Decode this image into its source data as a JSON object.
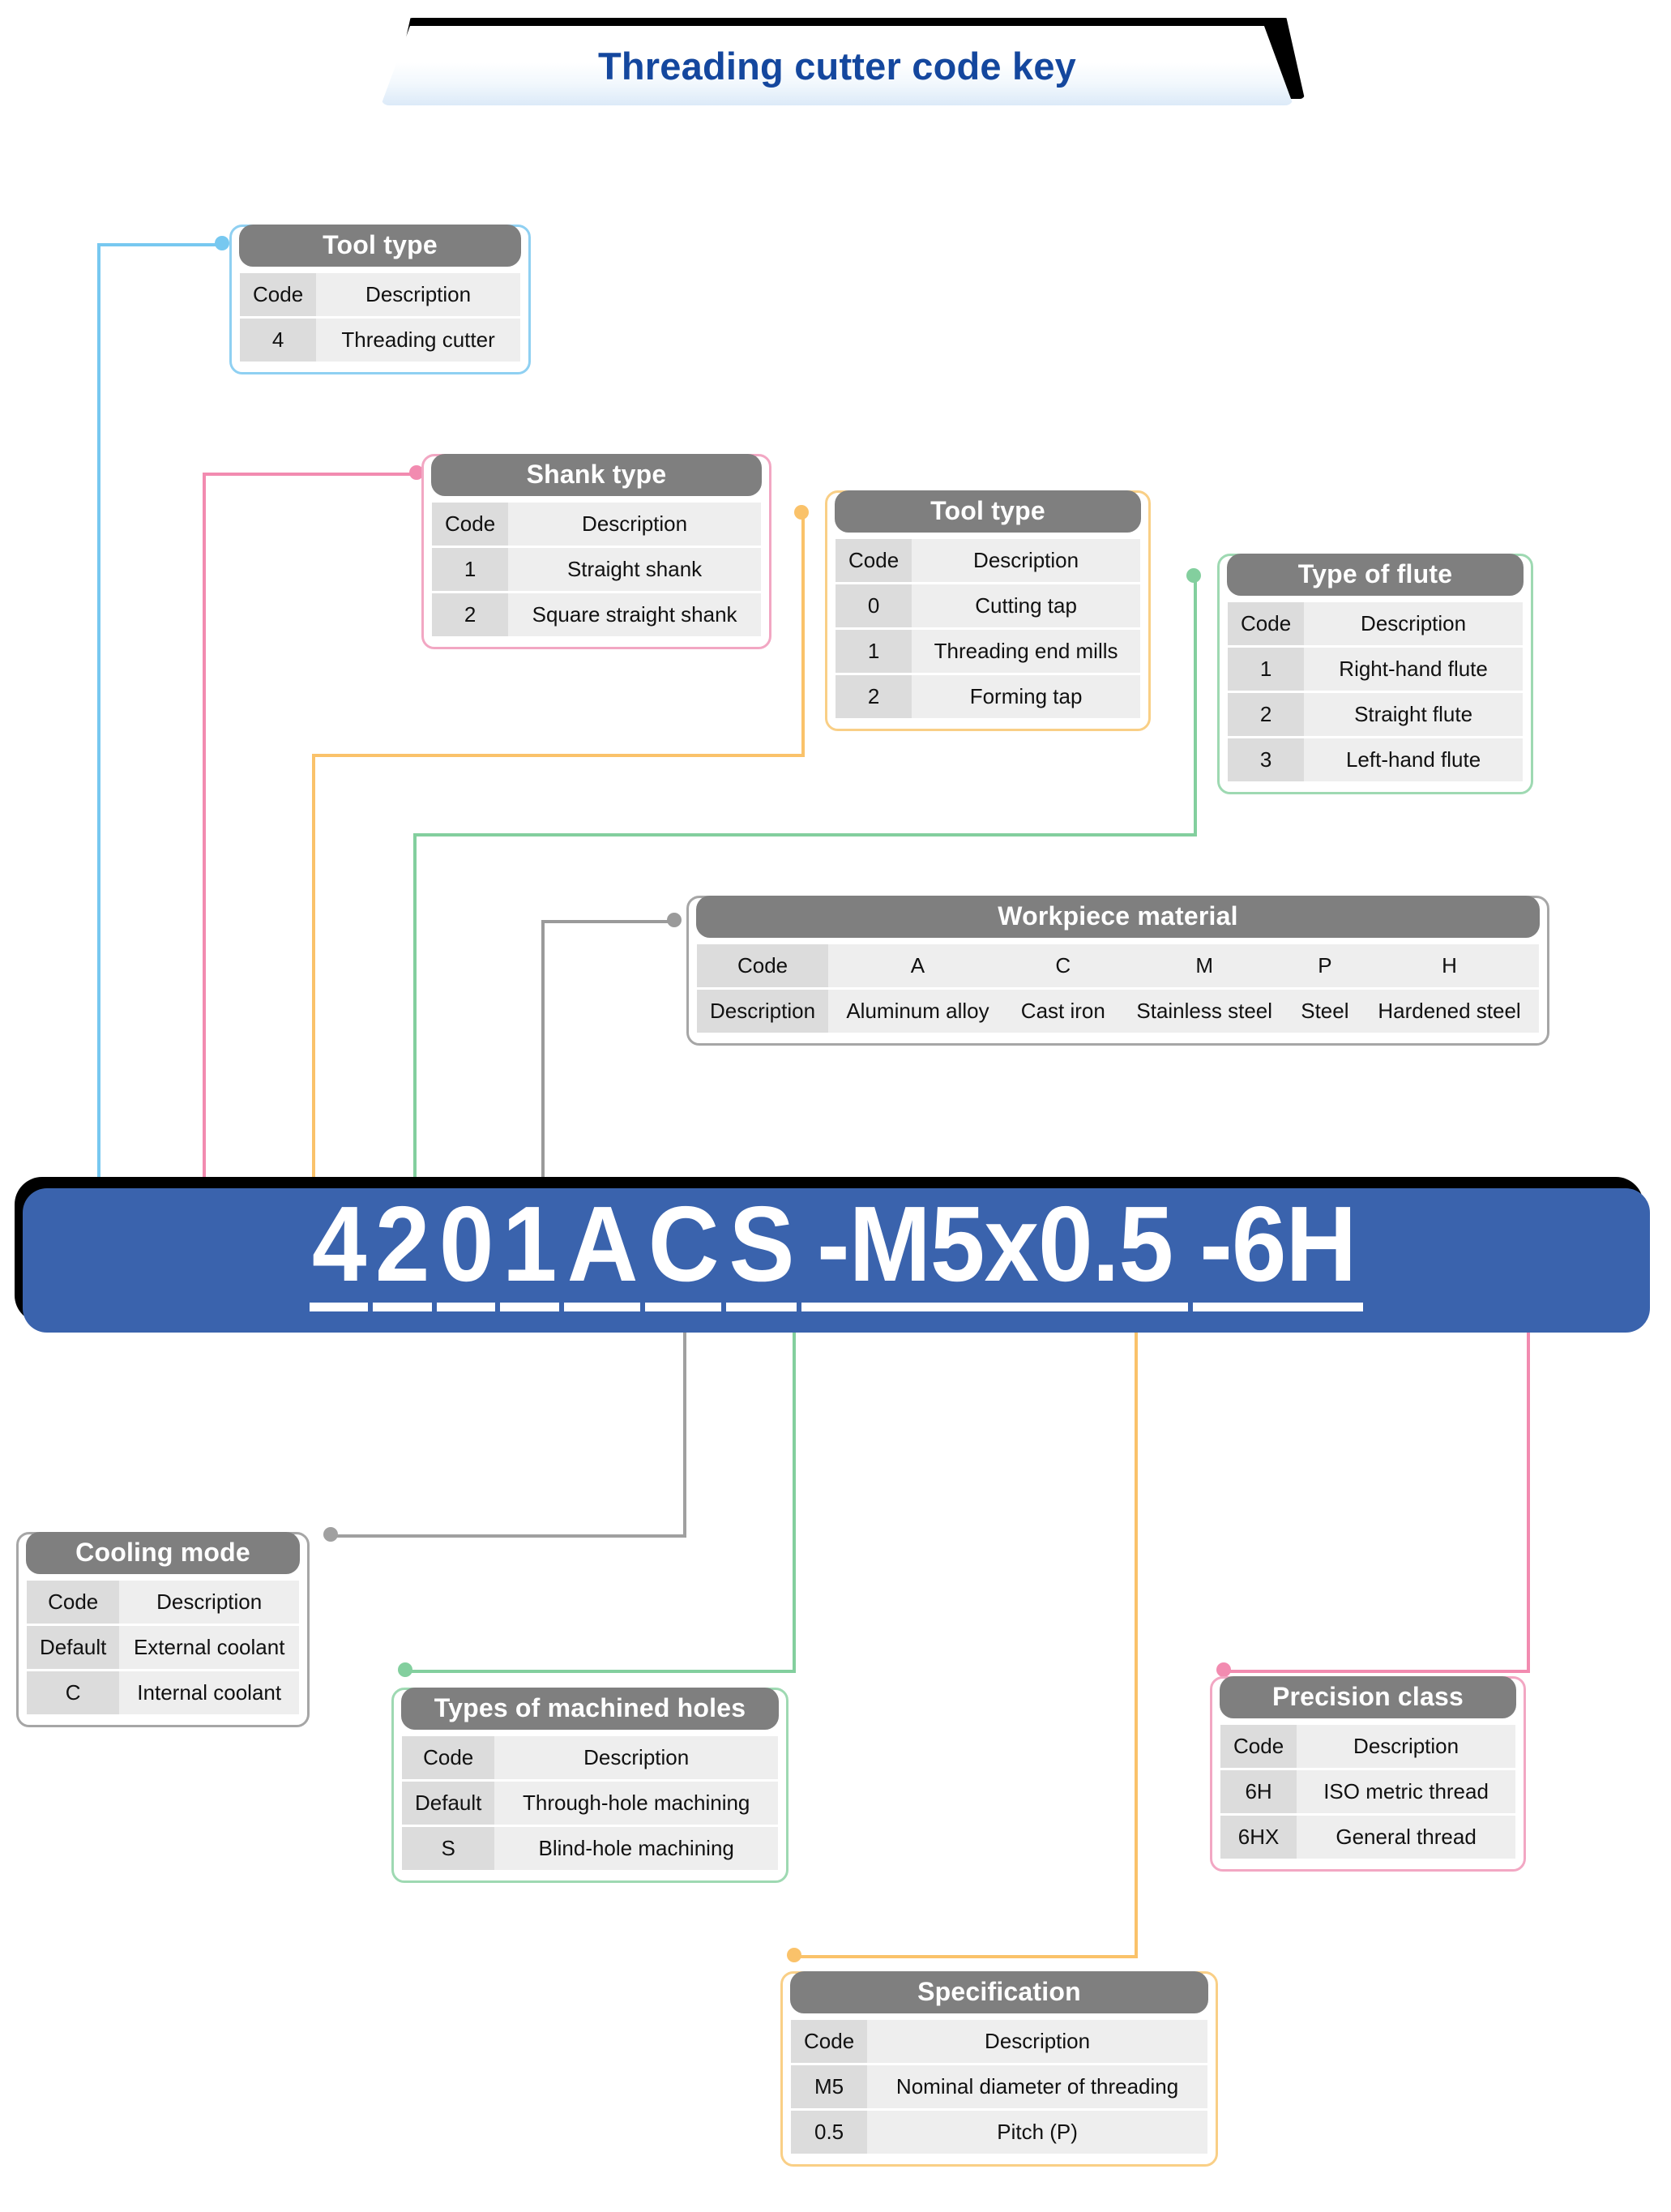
{
  "title": {
    "text": "Threading cutter code key"
  },
  "code_banner": {
    "full_code": "4 2 0 1 A C S -M5x0.5 -6H",
    "segments": [
      {
        "glyph": "4"
      },
      {
        "glyph": "2"
      },
      {
        "glyph": "0"
      },
      {
        "glyph": "1"
      },
      {
        "glyph": "A"
      },
      {
        "glyph": "C"
      },
      {
        "glyph": "S"
      },
      {
        "glyph": "-M5x0.5"
      },
      {
        "glyph": "-6H"
      }
    ]
  },
  "cards": {
    "tool_type_top": {
      "title": "Tool type",
      "headers": [
        "Code",
        "Description"
      ],
      "rows": [
        [
          "4",
          "Threading cutter"
        ]
      ]
    },
    "shank_type": {
      "title": "Shank type",
      "headers": [
        "Code",
        "Description"
      ],
      "rows": [
        [
          "1",
          "Straight shank"
        ],
        [
          "2",
          "Square straight shank"
        ]
      ]
    },
    "tool_type_mid": {
      "title": "Tool type",
      "headers": [
        "Code",
        "Description"
      ],
      "rows": [
        [
          "0",
          "Cutting tap"
        ],
        [
          "1",
          "Threading end mills"
        ],
        [
          "2",
          "Forming tap"
        ]
      ]
    },
    "type_of_flute": {
      "title": "Type of flute",
      "headers": [
        "Code",
        "Description"
      ],
      "rows": [
        [
          "1",
          "Right-hand flute"
        ],
        [
          "2",
          "Straight flute"
        ],
        [
          "3",
          "Left-hand flute"
        ]
      ]
    },
    "workpiece_material": {
      "title": "Workpiece material",
      "row_code": [
        "Code",
        "A",
        "C",
        "M",
        "P",
        "H"
      ],
      "row_description": [
        "Description",
        "Aluminum alloy",
        "Cast iron",
        "Stainless steel",
        "Steel",
        "Hardened steel"
      ]
    },
    "cooling_mode": {
      "title": "Cooling mode",
      "headers": [
        "Code",
        "Description"
      ],
      "rows": [
        [
          "Default",
          "External coolant"
        ],
        [
          "C",
          "Internal coolant"
        ]
      ]
    },
    "machined_holes": {
      "title": "Types of machined holes",
      "headers": [
        "Code",
        "Description"
      ],
      "rows": [
        [
          "Default",
          "Through-hole machining"
        ],
        [
          "S",
          "Blind-hole machining"
        ]
      ]
    },
    "precision_class": {
      "title": "Precision class",
      "headers": [
        "Code",
        "Description"
      ],
      "rows": [
        [
          "6H",
          "ISO metric thread"
        ],
        [
          "6HX",
          "General thread"
        ]
      ]
    },
    "specification": {
      "title": "Specification",
      "headers": [
        "Code",
        "Description"
      ],
      "rows": [
        [
          "M5",
          "Nominal diameter of threading"
        ],
        [
          "0.5",
          "Pitch (P)"
        ]
      ]
    }
  },
  "colors": {
    "code_banner_bg": "#3a63ad",
    "title_text": "#14479e",
    "card_header_bg": "#7f7f7f",
    "connector_blue": "#77c8f0",
    "connector_pink": "#f28bb0",
    "connector_orange": "#fac26a",
    "connector_green": "#83cf9e",
    "connector_gray": "#a0a0a0"
  }
}
